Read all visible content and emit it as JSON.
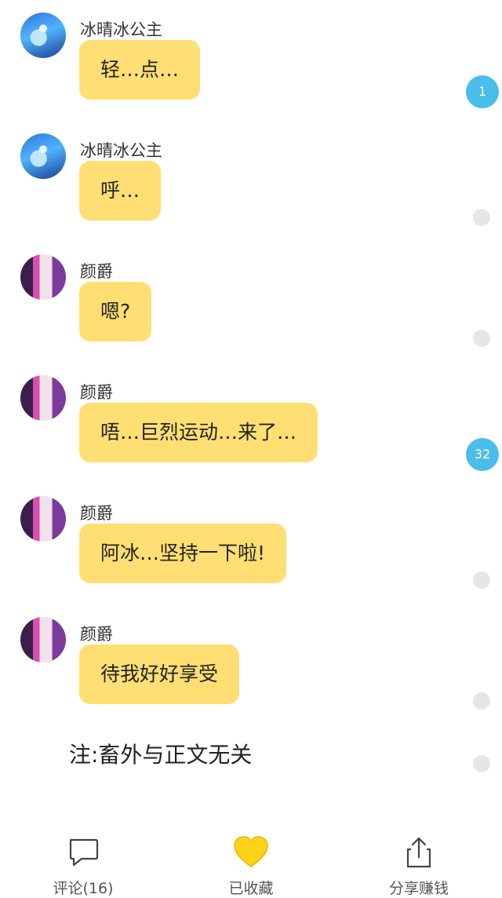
{
  "messages": [
    {
      "sender": "冰晴冰公主",
      "text": "轻…点…",
      "avatar": "blue-haired-princess-avatar"
    },
    {
      "sender": "冰晴冰公主",
      "text": "呼…",
      "avatar": "blue-haired-princess-avatar"
    },
    {
      "sender": "颜爵",
      "text": "嗯?",
      "avatar": "purple-haired-avatar"
    },
    {
      "sender": "颜爵",
      "text": "唔…巨烈运动…来了…",
      "avatar": "purple-haired-avatar"
    },
    {
      "sender": "颜爵",
      "text": "阿冰…坚持一下啦!",
      "avatar": "purple-haired-avatar"
    },
    {
      "sender": "颜爵",
      "text": "待我好好享受",
      "avatar": "purple-haired-avatar"
    }
  ],
  "note": "注:畜外与正文无关",
  "paragraph_comment_badges": [
    "1",
    "32"
  ],
  "bottom_bar": {
    "comment_label": "评论(16)",
    "favorite_label": "已收藏",
    "share_label": "分享赚钱"
  },
  "colors": {
    "bubble": "#ffdf73",
    "badge": "#4bbdea",
    "heart": "#ffd21a"
  },
  "icons": [
    "comment-icon",
    "heart-icon",
    "share-icon"
  ]
}
